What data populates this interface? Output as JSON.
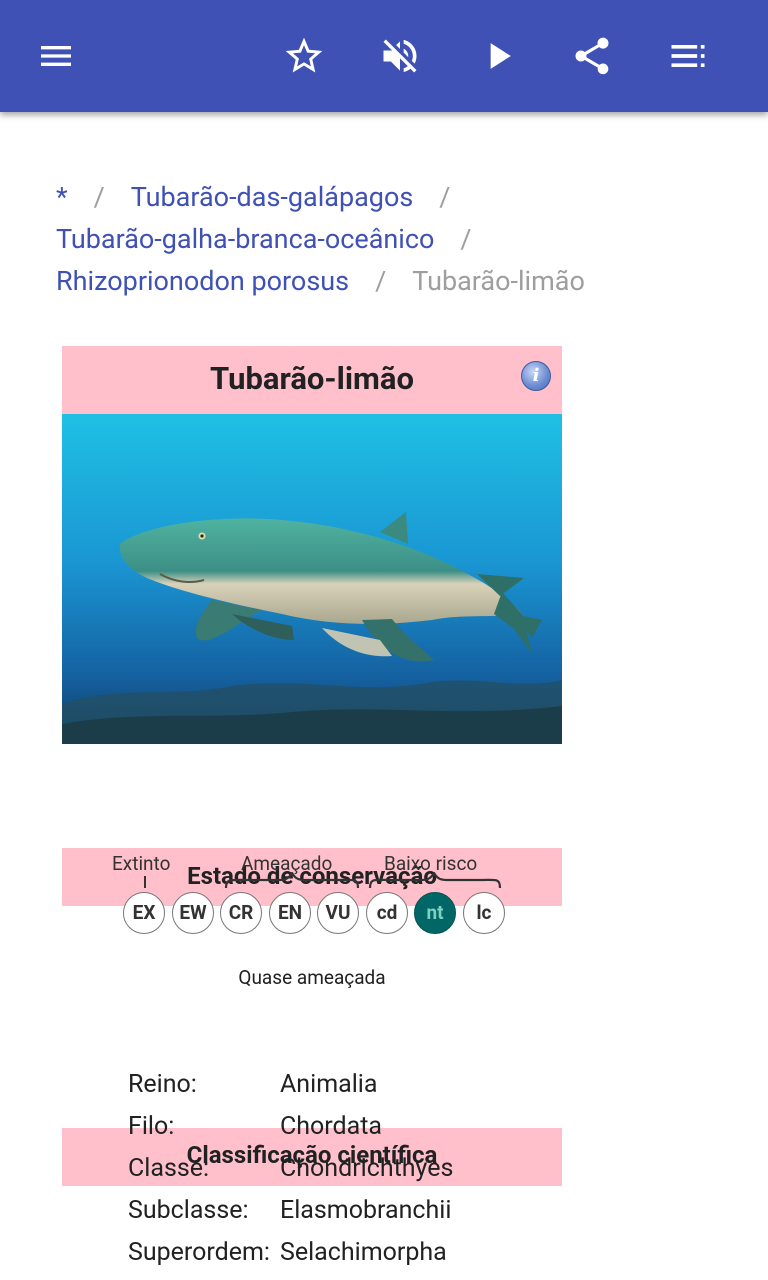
{
  "colors": {
    "primary": "#3f51b5",
    "header_pink": "#ffc0cb",
    "status_active": "#006666"
  },
  "toolbar": {
    "icons": [
      "menu-icon",
      "star-outline-icon",
      "volume-off-icon",
      "play-icon",
      "share-icon",
      "playlist-icon"
    ]
  },
  "breadcrumb": {
    "items": [
      "*",
      "Tubarão-das-galápagos",
      "Tubarão-galha-branca-oceânico",
      "Rhizoprionodon porosus"
    ],
    "separator": "/",
    "current": "Tubarão-limão"
  },
  "infobox": {
    "title": "Tubarão-limão",
    "info_glyph": "i",
    "conservation_header": "Estado de conservação",
    "scale": {
      "group_extinct": "Extinto",
      "group_threatened": "Ameaçado",
      "group_low_risk": "Baixo risco",
      "codes": [
        "EX",
        "EW",
        "CR",
        "EN",
        "VU",
        "cd",
        "nt",
        "lc"
      ],
      "active": "nt"
    },
    "status_caption": "Quase ameaçada",
    "classification_header": "Classificação científica",
    "taxonomy": [
      {
        "rank": "Reino:",
        "value": "Animalia"
      },
      {
        "rank": "Filo:",
        "value": "Chordata"
      },
      {
        "rank": "Classe:",
        "value": "Chondrichthyes"
      },
      {
        "rank": "Subclasse:",
        "value": "Elasmobranchii"
      },
      {
        "rank": "Superordem:",
        "value": "Selachimorpha"
      }
    ]
  }
}
